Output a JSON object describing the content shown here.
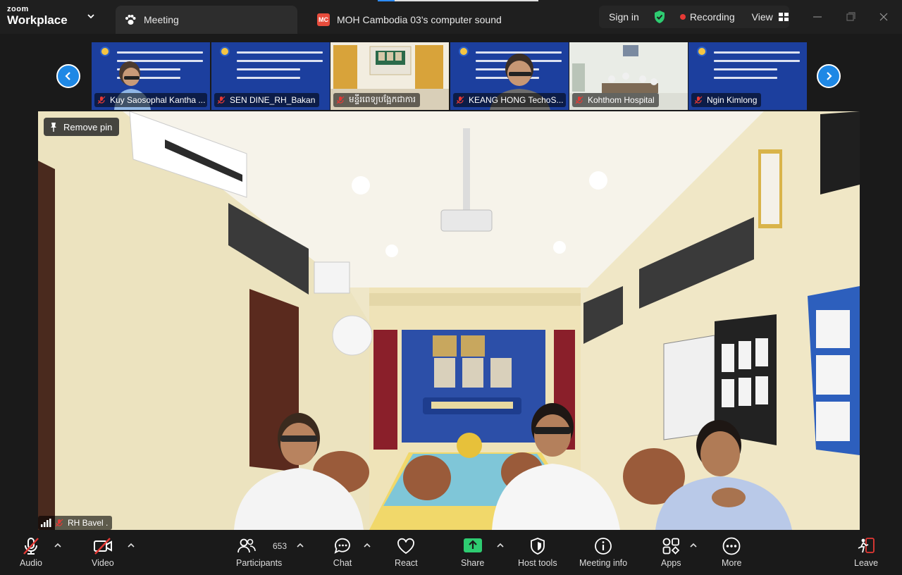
{
  "app": {
    "brand_top": "zoom",
    "brand_bottom": "Workplace"
  },
  "tabs": [
    {
      "label": "Meeting"
    },
    {
      "label": "MOH Cambodia 03's computer sound",
      "badge": "MC"
    }
  ],
  "topbar": {
    "sign_in": "Sign in",
    "recording": "Recording",
    "view": "View"
  },
  "colors": {
    "accent": "#1e88e5",
    "recording": "#e53935",
    "secure": "#2ecc71",
    "share": "#2ecc71",
    "leave": "#e53935"
  },
  "thumbnails": [
    {
      "name": "Kuy Saosophal Kantha ..."
    },
    {
      "name": "SEN DINE_RH_Bakan"
    },
    {
      "name": "មន្ទីរពេទ្យបង្អែកជាការ"
    },
    {
      "name": "KEANG HONG TechoS..."
    },
    {
      "name": "Kohthom Hospital"
    },
    {
      "name": "Ngin Kimlong"
    }
  ],
  "main_video": {
    "pin_label": "Remove pin",
    "speaker": "RH Bavel ."
  },
  "controls": {
    "audio": "Audio",
    "video": "Video",
    "participants": "Participants",
    "participant_count": "653",
    "chat": "Chat",
    "react": "React",
    "share": "Share",
    "host_tools": "Host tools",
    "meeting_info": "Meeting info",
    "apps": "Apps",
    "more": "More",
    "leave": "Leave"
  }
}
